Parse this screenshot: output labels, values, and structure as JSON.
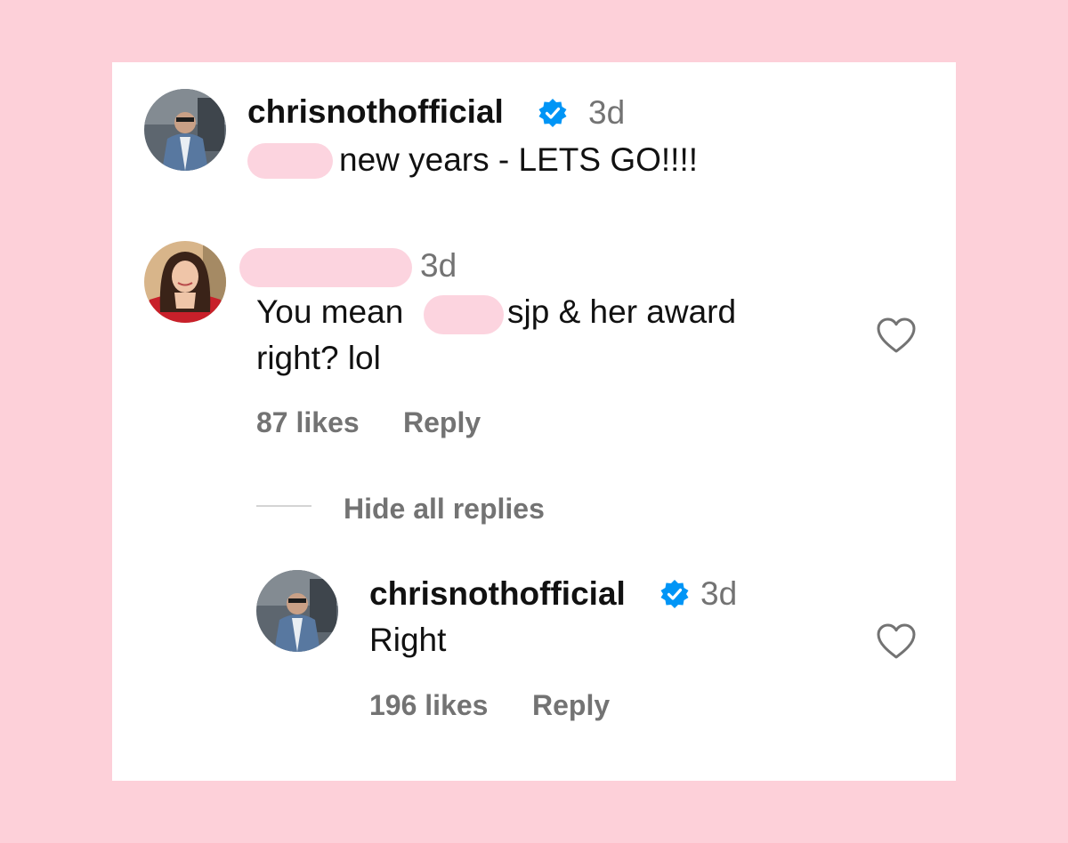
{
  "comment": {
    "username": "chrisnothofficial",
    "time": "3d",
    "text": "new years - LETS GO!!!!"
  },
  "reply_comment": {
    "time": "3d",
    "text_before": "You mean",
    "text_after": "sjp & her award",
    "text_line2": "right? lol",
    "likes": "87 likes",
    "reply_label": "Reply"
  },
  "thread": {
    "hide_replies_label": "Hide all replies"
  },
  "nested_reply": {
    "username": "chrisnothofficial",
    "time": "3d",
    "text": "Right",
    "likes": "196 likes",
    "reply_label": "Reply"
  },
  "colors": {
    "background": "#fdd0d9",
    "verified_badge": "#0095f6",
    "secondary_text": "#737373"
  }
}
